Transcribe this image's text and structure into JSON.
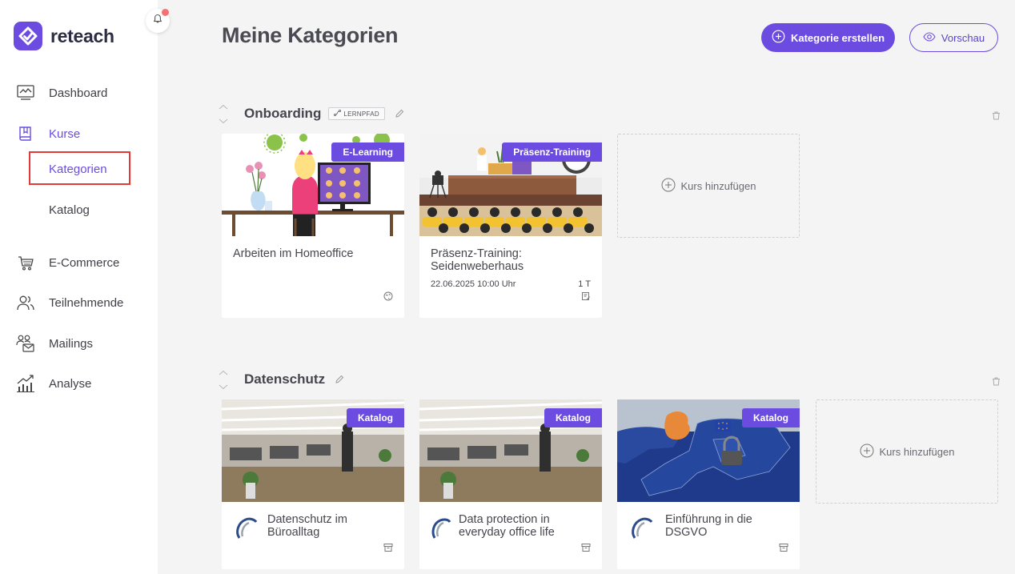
{
  "brand": {
    "name": "reteach"
  },
  "nav": {
    "dashboard": "Dashboard",
    "kurse": "Kurse",
    "kategorien": "Kategorien",
    "katalog": "Katalog",
    "ecommerce": "E-Commerce",
    "teilnehmende": "Teilnehmende",
    "mailings": "Mailings",
    "analyse": "Analyse"
  },
  "header": {
    "title": "Meine Kategorien",
    "create_label": "Kategorie erstellen",
    "preview_label": "Vorschau"
  },
  "sections": [
    {
      "title": "Onboarding",
      "tag": "LERNPFAD",
      "cards": [
        {
          "badge": "E-Learning",
          "title": "Arbeiten im Homeoffice"
        },
        {
          "badge": "Präsenz-Training",
          "title": "Präsenz-Training: Seidenweberhaus",
          "date": "22.06.2025 10:00 Uhr",
          "duration": "1 T"
        }
      ],
      "add_label": "Kurs hinzufügen"
    },
    {
      "title": "Datenschutz",
      "cards": [
        {
          "badge": "Katalog",
          "title": "Datenschutz im Büroalltag"
        },
        {
          "badge": "Katalog",
          "title": "Data protection in everyday office life"
        },
        {
          "badge": "Katalog",
          "title": "Einführung in die DSGVO"
        }
      ],
      "add_label": "Kurs hinzufügen"
    }
  ],
  "colors": {
    "accent": "#6c4ce0",
    "highlight": "#e53935",
    "notification": "#f87171"
  }
}
